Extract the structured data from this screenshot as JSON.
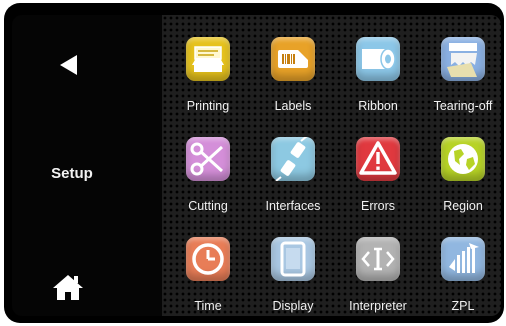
{
  "sidebar": {
    "title": "Setup",
    "back_icon": "back-arrow-icon",
    "home_icon": "home-icon"
  },
  "tiles": [
    {
      "label": "Printing",
      "icon": "printing-icon",
      "color": "#e6c21d"
    },
    {
      "label": "Labels",
      "icon": "labels-icon",
      "color": "#e8a228"
    },
    {
      "label": "Ribbon",
      "icon": "ribbon-icon",
      "color": "#8cc7e8"
    },
    {
      "label": "Tearing-off",
      "icon": "tearing-off-icon",
      "color": "#8ab0e2"
    },
    {
      "label": "Cutting",
      "icon": "scissors-icon",
      "color": "#d48fd9"
    },
    {
      "label": "Interfaces",
      "icon": "interfaces-icon",
      "color": "#8dc9e2"
    },
    {
      "label": "Errors",
      "icon": "warning-icon",
      "color": "#e0393f"
    },
    {
      "label": "Region",
      "icon": "globe-icon",
      "color": "#b7d326"
    },
    {
      "label": "Time",
      "icon": "clock-icon",
      "color": "#e87d57"
    },
    {
      "label": "Display",
      "icon": "display-icon",
      "color": "#a9c7e2"
    },
    {
      "label": "Interpreter",
      "icon": "interpreter-icon",
      "color": "#b3b3b3"
    },
    {
      "label": "ZPL",
      "icon": "zpl-icon",
      "color": "#91b7e0"
    }
  ]
}
